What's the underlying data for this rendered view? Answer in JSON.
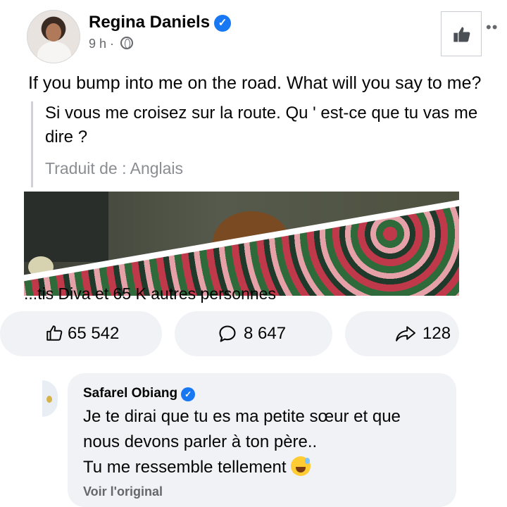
{
  "post": {
    "author": "Regina Daniels",
    "time": "9 h",
    "separator": "·",
    "text": "If you bump into me on the road. What will you say to me?",
    "translation": "Si vous me croisez sur la route. Qu ' est-ce que tu vas me dire ?",
    "translation_source": "Traduit de : Anglais",
    "more": "••"
  },
  "reactions": {
    "summary": "...tis Diva et 65 K autres personnes",
    "likes": "65 542",
    "comments": "8 647",
    "shares": "128"
  },
  "comment": {
    "author": "Safarel Obiang",
    "line1": "Je te dirai que tu es ma petite sœur et que",
    "line2": "nous devons parler à ton père..",
    "line3": "Tu me ressemble tellement",
    "see_original": "Voir l'original"
  },
  "icons": {
    "verified": "verified-badge-icon",
    "globe": "globe-icon",
    "like_page": "thumbs-up-icon",
    "like": "like-outline-icon",
    "comment": "comment-bubble-icon",
    "share": "share-arrow-icon",
    "emoji": "grinning-sweat-emoji"
  },
  "colors": {
    "verified": "#1877f2",
    "muted": "#65676b",
    "pill": "#f0f2f5"
  }
}
